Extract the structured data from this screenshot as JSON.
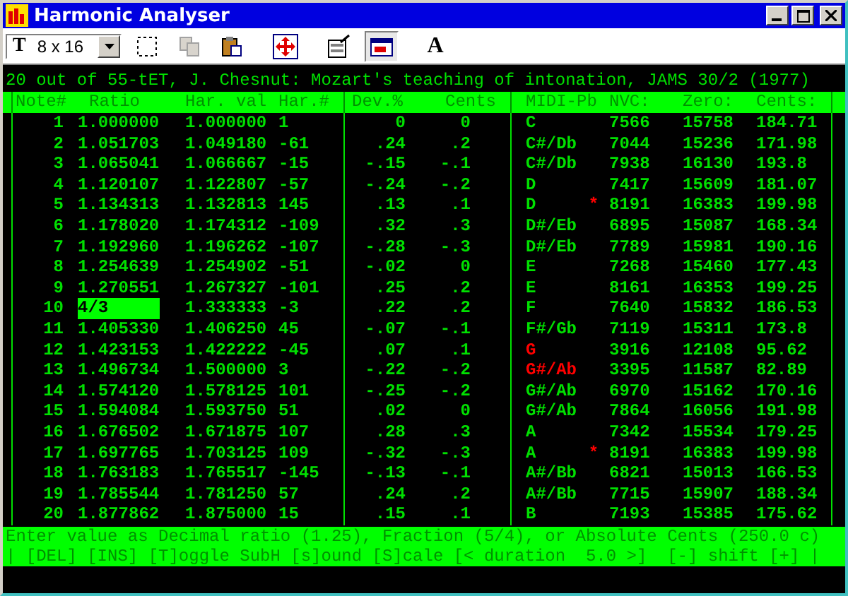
{
  "window": {
    "title": "Harmonic Analyser"
  },
  "toolbar": {
    "font_dropdown": {
      "glyph": "T",
      "value": "8 x 16"
    },
    "buttons": [
      {
        "kind": "select",
        "disabled": false,
        "pressed": false
      },
      {
        "kind": "copy",
        "disabled": true,
        "pressed": false
      },
      {
        "kind": "paste",
        "disabled": false,
        "pressed": false
      },
      {
        "kind": "arrows",
        "disabled": false,
        "pressed": false
      },
      {
        "kind": "properties",
        "disabled": false,
        "pressed": false
      },
      {
        "kind": "window",
        "disabled": false,
        "pressed": true
      },
      {
        "kind": "font",
        "label": "A",
        "disabled": false,
        "pressed": false
      }
    ]
  },
  "heading": "20 out of 55-tET, J. Chesnut: Mozart's teaching of intonation, JAMS 30/2 (1977)",
  "table": {
    "columns": [
      "Note#",
      "Ratio",
      "Har. val",
      "Har.#",
      "Dev.%",
      "Cents",
      "MIDI-Pb",
      "NVC:",
      "Zero:",
      "Cents:"
    ],
    "rows": [
      {
        "note": "1",
        "ratio": "1.000000",
        "har_val": "1.000000",
        "har_num": "1",
        "dev": "0",
        "cents": "0",
        "midi": "C",
        "flagged": false,
        "nvc": "7566",
        "zero": "15758",
        "cents_value": "184.71",
        "editing": false
      },
      {
        "note": "2",
        "ratio": "1.051703",
        "har_val": "1.049180",
        "har_num": "-61",
        "dev": ".24",
        "cents": ".2",
        "midi": "C#/Db",
        "flagged": false,
        "nvc": "7044",
        "zero": "15236",
        "cents_value": "171.98",
        "editing": false
      },
      {
        "note": "3",
        "ratio": "1.065041",
        "har_val": "1.066667",
        "har_num": "-15",
        "dev": "-.15",
        "cents": "-.1",
        "midi": "C#/Db",
        "flagged": false,
        "nvc": "7938",
        "zero": "16130",
        "cents_value": "193.8",
        "editing": false
      },
      {
        "note": "4",
        "ratio": "1.120107",
        "har_val": "1.122807",
        "har_num": "-57",
        "dev": "-.24",
        "cents": "-.2",
        "midi": "D",
        "flagged": false,
        "nvc": "7417",
        "zero": "15609",
        "cents_value": "181.07",
        "editing": false
      },
      {
        "note": "5",
        "ratio": "1.134313",
        "har_val": "1.132813",
        "har_num": "145",
        "dev": ".13",
        "cents": ".1",
        "midi": "D",
        "marker": "*",
        "flagged": false,
        "nvc": "8191",
        "zero": "16383",
        "cents_value": "199.98",
        "editing": false
      },
      {
        "note": "6",
        "ratio": "1.178020",
        "har_val": "1.174312",
        "har_num": "-109",
        "dev": ".32",
        "cents": ".3",
        "midi": "D#/Eb",
        "flagged": false,
        "nvc": "6895",
        "zero": "15087",
        "cents_value": "168.34",
        "editing": false
      },
      {
        "note": "7",
        "ratio": "1.192960",
        "har_val": "1.196262",
        "har_num": "-107",
        "dev": "-.28",
        "cents": "-.3",
        "midi": "D#/Eb",
        "flagged": false,
        "nvc": "7789",
        "zero": "15981",
        "cents_value": "190.16",
        "editing": false
      },
      {
        "note": "8",
        "ratio": "1.254639",
        "har_val": "1.254902",
        "har_num": "-51",
        "dev": "-.02",
        "cents": "0",
        "midi": "E",
        "flagged": false,
        "nvc": "7268",
        "zero": "15460",
        "cents_value": "177.43",
        "editing": false
      },
      {
        "note": "9",
        "ratio": "1.270551",
        "har_val": "1.267327",
        "har_num": "-101",
        "dev": ".25",
        "cents": ".2",
        "midi": "E",
        "flagged": false,
        "nvc": "8161",
        "zero": "16353",
        "cents_value": "199.25",
        "editing": false
      },
      {
        "note": "10",
        "ratio": "4/3",
        "har_val": "1.333333",
        "har_num": "-3",
        "dev": ".22",
        "cents": ".2",
        "midi": "F",
        "flagged": false,
        "nvc": "7640",
        "zero": "15832",
        "cents_value": "186.53",
        "editing": true
      },
      {
        "note": "11",
        "ratio": "1.405330",
        "har_val": "1.406250",
        "har_num": "45",
        "dev": "-.07",
        "cents": "-.1",
        "midi": "F#/Gb",
        "flagged": false,
        "nvc": "7119",
        "zero": "15311",
        "cents_value": "173.8",
        "editing": false
      },
      {
        "note": "12",
        "ratio": "1.423153",
        "har_val": "1.422222",
        "har_num": "-45",
        "dev": ".07",
        "cents": ".1",
        "midi": "G",
        "flagged": true,
        "nvc": "3916",
        "zero": "12108",
        "cents_value": "95.62",
        "editing": false
      },
      {
        "note": "13",
        "ratio": "1.496734",
        "har_val": "1.500000",
        "har_num": "3",
        "dev": "-.22",
        "cents": "-.2",
        "midi": "G#/Ab",
        "flagged": true,
        "nvc": "3395",
        "zero": "11587",
        "cents_value": "82.89",
        "editing": false
      },
      {
        "note": "14",
        "ratio": "1.574120",
        "har_val": "1.578125",
        "har_num": "101",
        "dev": "-.25",
        "cents": "-.2",
        "midi": "G#/Ab",
        "flagged": false,
        "nvc": "6970",
        "zero": "15162",
        "cents_value": "170.16",
        "editing": false
      },
      {
        "note": "15",
        "ratio": "1.594084",
        "har_val": "1.593750",
        "har_num": "51",
        "dev": ".02",
        "cents": "0",
        "midi": "G#/Ab",
        "flagged": false,
        "nvc": "7864",
        "zero": "16056",
        "cents_value": "191.98",
        "editing": false
      },
      {
        "note": "16",
        "ratio": "1.676502",
        "har_val": "1.671875",
        "har_num": "107",
        "dev": ".28",
        "cents": ".3",
        "midi": "A",
        "flagged": false,
        "nvc": "7342",
        "zero": "15534",
        "cents_value": "179.25",
        "editing": false
      },
      {
        "note": "17",
        "ratio": "1.697765",
        "har_val": "1.703125",
        "har_num": "109",
        "dev": "-.32",
        "cents": "-.3",
        "midi": "A",
        "marker": "*",
        "flagged": false,
        "nvc": "8191",
        "zero": "16383",
        "cents_value": "199.98",
        "editing": false
      },
      {
        "note": "18",
        "ratio": "1.763183",
        "har_val": "1.765517",
        "har_num": "-145",
        "dev": "-.13",
        "cents": "-.1",
        "midi": "A#/Bb",
        "flagged": false,
        "nvc": "6821",
        "zero": "15013",
        "cents_value": "166.53",
        "editing": false
      },
      {
        "note": "19",
        "ratio": "1.785544",
        "har_val": "1.781250",
        "har_num": "57",
        "dev": ".24",
        "cents": ".2",
        "midi": "A#/Bb",
        "flagged": false,
        "nvc": "7715",
        "zero": "15907",
        "cents_value": "188.34",
        "editing": false
      },
      {
        "note": "20",
        "ratio": "1.877862",
        "har_val": "1.875000",
        "har_num": "15",
        "dev": ".15",
        "cents": ".1",
        "midi": "B",
        "flagged": false,
        "nvc": "7193",
        "zero": "15385",
        "cents_value": "175.62",
        "editing": false
      }
    ]
  },
  "status_lines": [
    "Enter value as Decimal ratio (1.25), Fraction (5/4), or Absolute Cents (250.0 c)",
    "| [DEL] [INS] [T]oggle SubH [s]ound [S]cale [< duration  5.0 >]  [-] shift [+] |"
  ]
}
